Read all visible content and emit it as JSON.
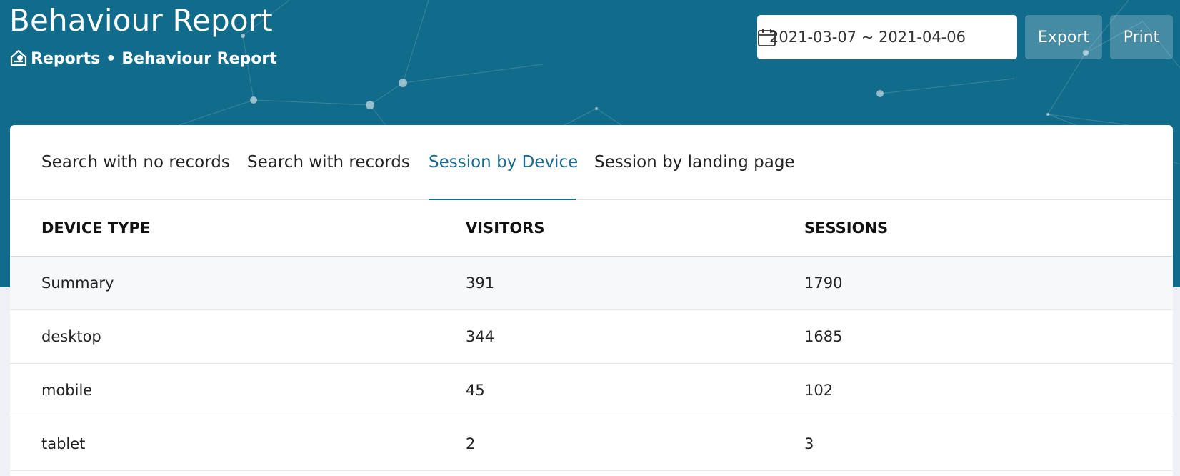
{
  "header": {
    "title": "Behaviour Report",
    "breadcrumb": {
      "home_icon": "home-icon",
      "items": [
        "Reports",
        "Behaviour Report"
      ],
      "separator": "•"
    },
    "date_range": {
      "value": "2021-03-07 ~ 2021-04-06",
      "icon": "calendar-icon"
    },
    "export_label": "Export",
    "print_label": "Print",
    "background_color": "#116b8b"
  },
  "tabs": [
    {
      "label": "Search with no records"
    },
    {
      "label": "Search with records"
    },
    {
      "label": "Session by Device"
    },
    {
      "label": "Session by landing page"
    }
  ],
  "active_tab": "Session by Device",
  "accent_color": "#1a6a8c",
  "table": {
    "columns": [
      "DEVICE TYPE",
      "VISITORS",
      "SESSIONS"
    ],
    "rows": [
      {
        "device": "Summary",
        "visitors": "391",
        "sessions": "1790"
      },
      {
        "device": "desktop",
        "visitors": "344",
        "sessions": "1685"
      },
      {
        "device": "mobile",
        "visitors": "45",
        "sessions": "102"
      },
      {
        "device": "tablet",
        "visitors": "2",
        "sessions": "3"
      }
    ]
  }
}
